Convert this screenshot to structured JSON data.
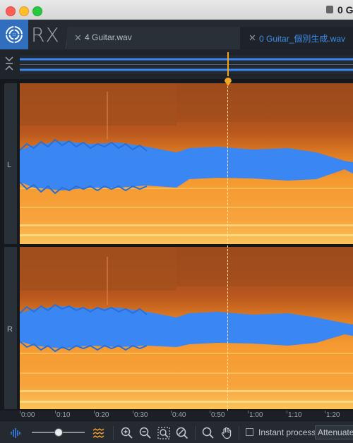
{
  "titlebar": {
    "title": "0 G"
  },
  "app": {
    "logo_text": "RX"
  },
  "tabs": [
    {
      "label": "4 Guitar.wav",
      "active": false
    },
    {
      "label": "0 Guitar_個別生成.wav",
      "active": true
    }
  ],
  "channels": [
    "L",
    "R"
  ],
  "ruler": {
    "ticks": [
      "0:00",
      "0:10",
      "0:20",
      "0:30",
      "0:40",
      "0:50",
      "1:00",
      "1:10",
      "1:20"
    ]
  },
  "toolbar": {
    "instant_process_label": "Instant process",
    "instant_process_checked": false,
    "mode_selected": "Attenuate",
    "zoom_level": 0.45
  },
  "colors": {
    "waveform": "#3a86f2",
    "spectrogram_hot": "#f7a33c",
    "spectrogram_cool": "#b8561e",
    "playhead": "#f0a520",
    "active_tab": "#3d8ff0"
  }
}
